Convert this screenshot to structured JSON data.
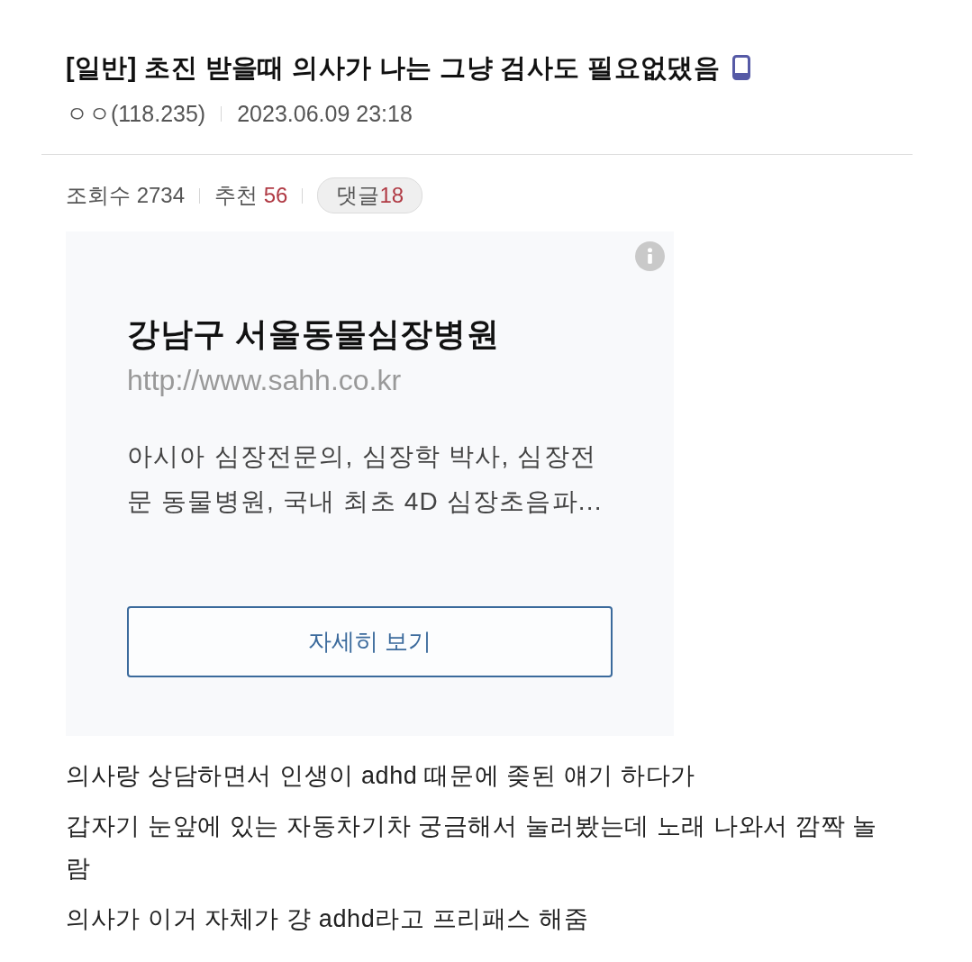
{
  "post": {
    "title": "[일반] 초진 받을때 의사가 나는 그냥 검사도 필요없댔음",
    "mobile": true,
    "author": "ㅇㅇ(118.235)",
    "date": "2023.06.09 23:18"
  },
  "stats": [
    {
      "label": "조회수",
      "value": "2734",
      "kind": "plain"
    },
    {
      "label": "추천",
      "value": "56",
      "kind": "highlight"
    },
    {
      "label": "댓글",
      "value": "18",
      "kind": "pill"
    }
  ],
  "ad": {
    "title": "강남구 서울동물심장병원",
    "url": "http://www.sahh.co.kr",
    "description": "아시아 심장전문의, 심장학 박사, 심장전문 동물병원, 국내 최초 4D 심장초음파...",
    "button": "자세히 보기"
  },
  "body": [
    "의사랑 상담하면서 인생이 adhd 때문에 좆된 얘기 하다가",
    "갑자기 눈앞에 있는 자동차기차 궁금해서 눌러봤는데 노래 나와서 깜짝 놀람",
    "의사가 이거 자체가 걍 adhd라고 프리패스 해줌"
  ]
}
